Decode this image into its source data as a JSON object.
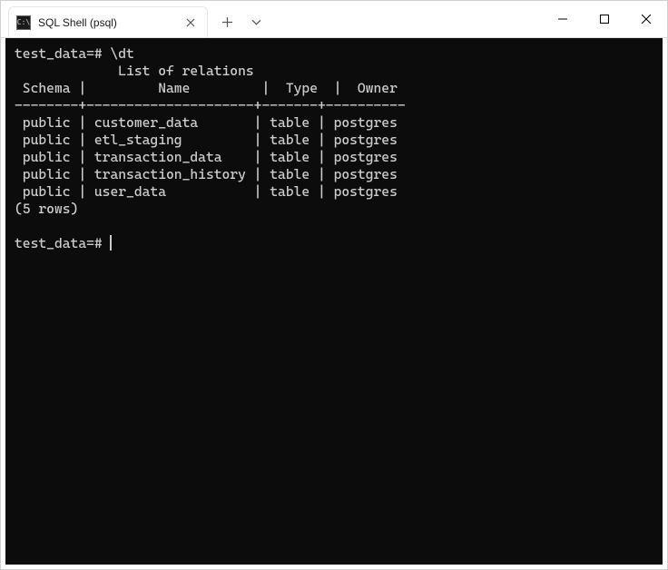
{
  "window": {
    "tab_title": "SQL Shell (psql)",
    "tab_icon_text": "C:\\"
  },
  "terminal": {
    "prompt": "test_data=#",
    "command": "\\dt",
    "header_title": "List of relations",
    "columns": {
      "schema": "Schema",
      "name": "Name",
      "type": "Type",
      "owner": "Owner"
    },
    "separator": "--------+---------------------+-------+----------",
    "rows": [
      {
        "schema": "public",
        "name": "customer_data",
        "type": "table",
        "owner": "postgres"
      },
      {
        "schema": "public",
        "name": "etl_staging",
        "type": "table",
        "owner": "postgres"
      },
      {
        "schema": "public",
        "name": "transaction_data",
        "type": "table",
        "owner": "postgres"
      },
      {
        "schema": "public",
        "name": "transaction_history",
        "type": "table",
        "owner": "postgres"
      },
      {
        "schema": "public",
        "name": "user_data",
        "type": "table",
        "owner": "postgres"
      }
    ],
    "row_count_text": "(5 rows)"
  }
}
